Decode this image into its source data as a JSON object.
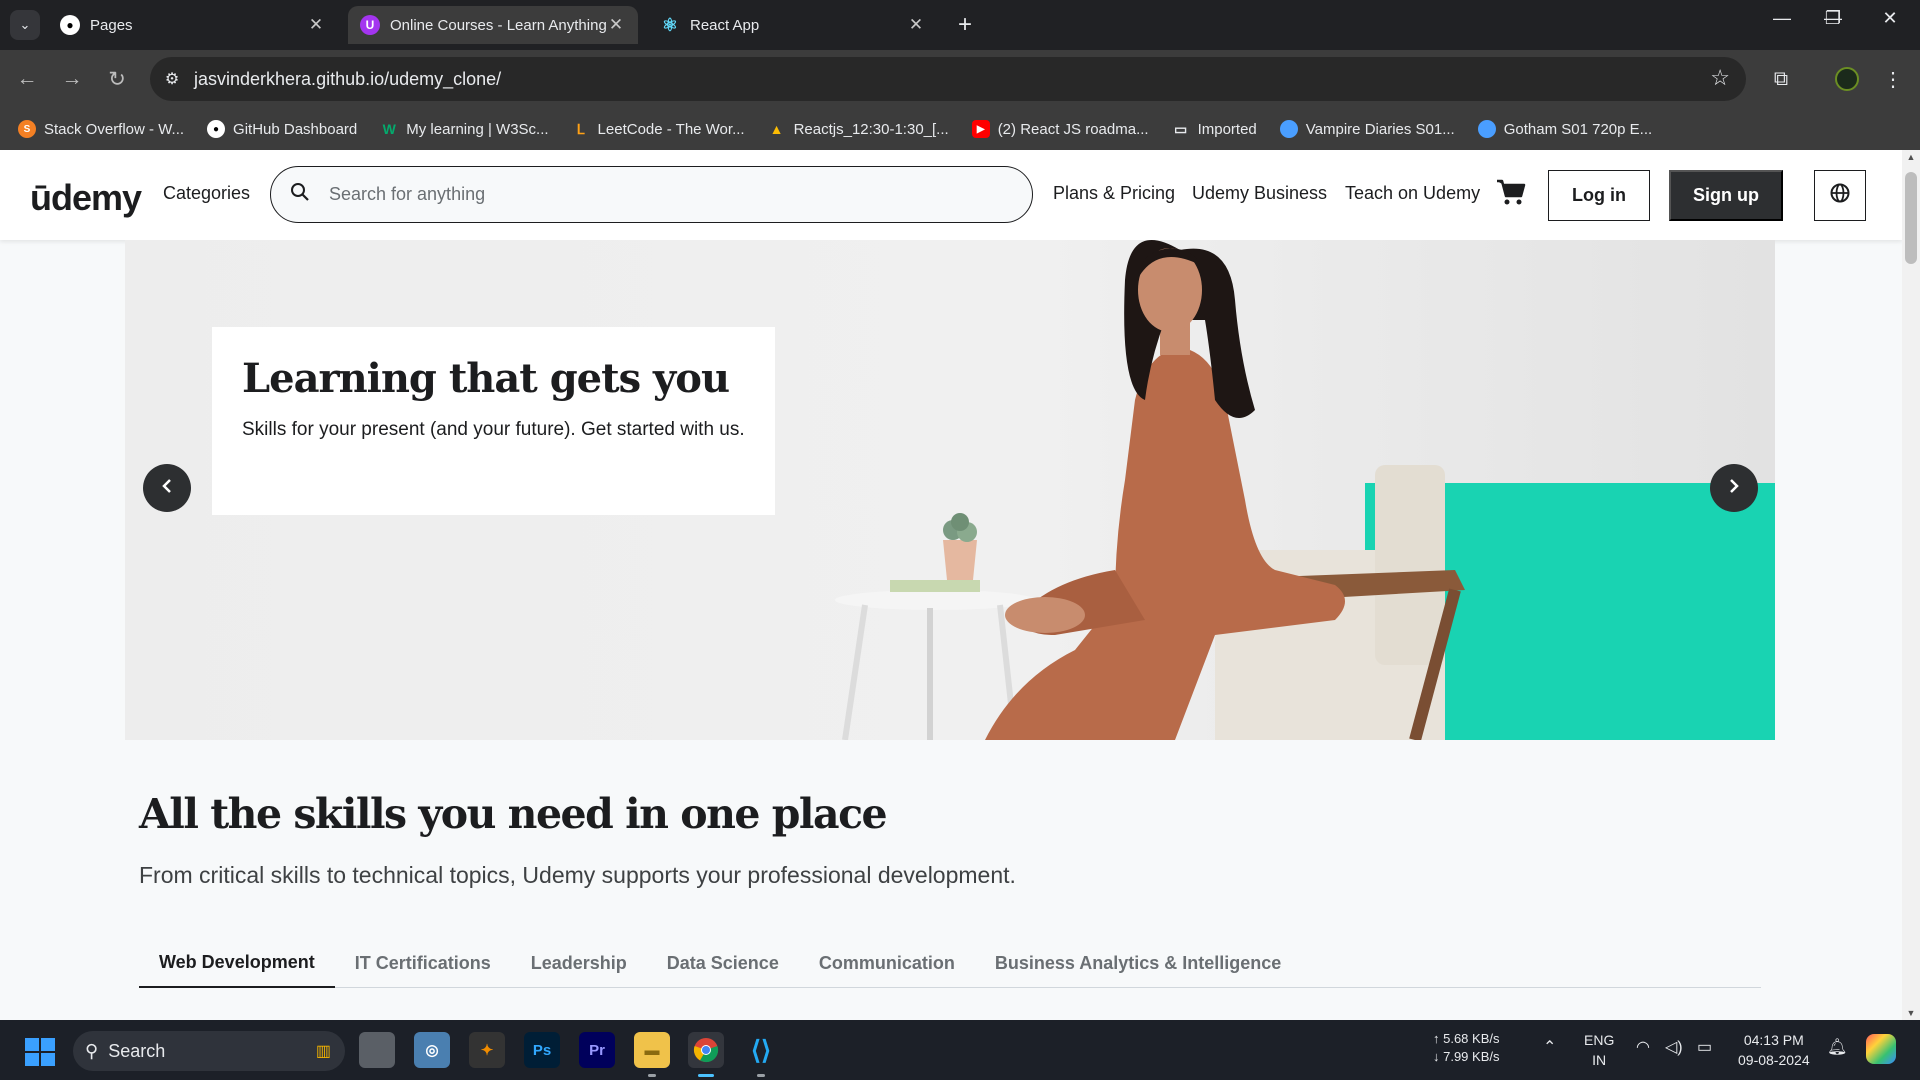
{
  "browser": {
    "tabs": [
      {
        "title": "Pages",
        "active": false
      },
      {
        "title": "Online Courses - Learn Anything",
        "active": true
      },
      {
        "title": "React App",
        "active": false
      }
    ],
    "url": "jasvinderkhera.github.io/udemy_clone/",
    "bookmarks": [
      "Stack Overflow - W...",
      "GitHub Dashboard",
      "My learning | W3Sc...",
      "LeetCode - The Wor...",
      "Reactjs_12:30-1:30_[...",
      "(2) React JS roadma...",
      "Imported",
      "Vampire Diaries S01...",
      "Gotham S01 720p E..."
    ]
  },
  "header": {
    "logo": "ūdemy",
    "categories": "Categories",
    "search_placeholder": "Search for anything",
    "links": [
      "Plans & Pricing",
      "Udemy Business",
      "Teach on Udemy"
    ],
    "login": "Log in",
    "signup": "Sign up"
  },
  "hero": {
    "title": "Learning that gets you",
    "subtitle": "Skills for your present (and your future). Get started with us."
  },
  "skills": {
    "title": "All the skills you need in one place",
    "subtitle": "From critical skills to technical topics, Udemy supports your professional development.",
    "tabs": [
      "Web Development",
      "IT Certifications",
      "Leadership",
      "Data Science",
      "Communication",
      "Business Analytics & Intelligence"
    ]
  },
  "taskbar": {
    "search": "Search",
    "net_up": "↑ 5.68 KB/s",
    "net_down": "↓ 7.99 KB/s",
    "lang1": "ENG",
    "lang2": "IN",
    "time": "04:13 PM",
    "date": "09-08-2024"
  },
  "colors": {
    "brand": "#a435f0",
    "teal": "#19d3b2",
    "dark": "#1c1d1f"
  }
}
